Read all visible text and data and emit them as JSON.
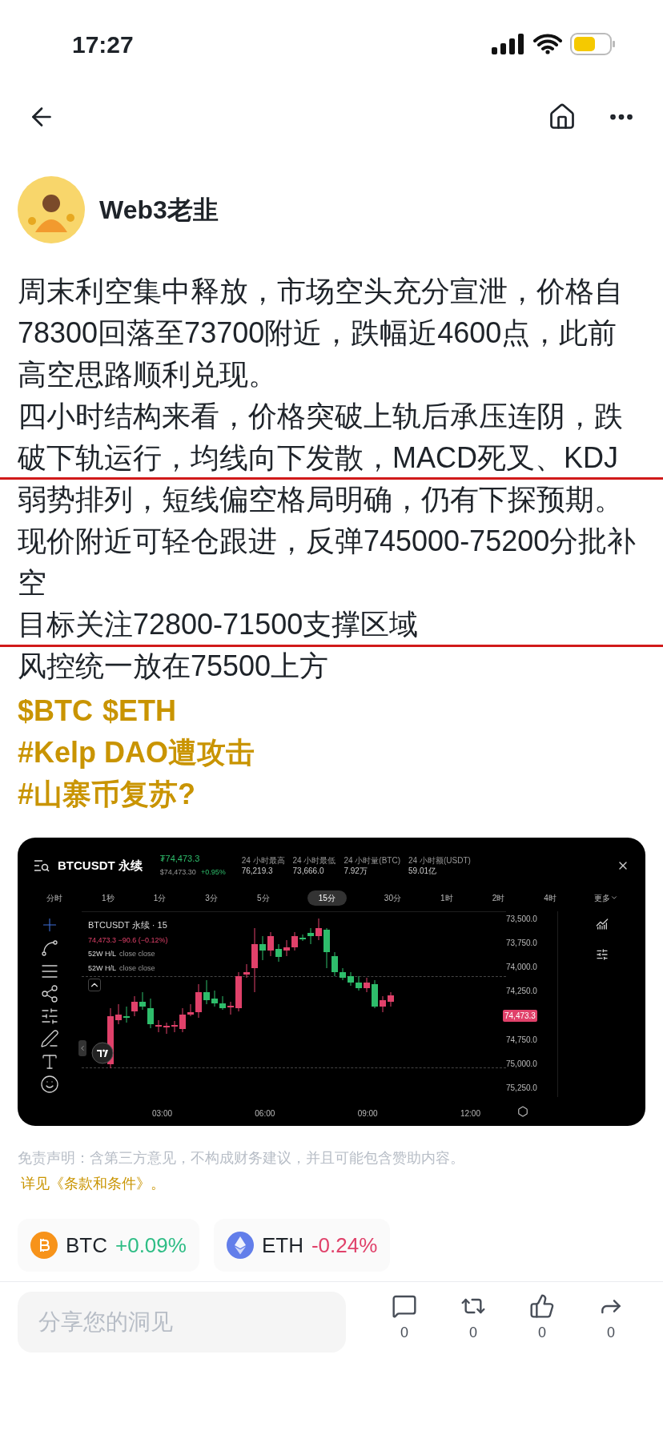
{
  "status_bar": {
    "time": "17:27"
  },
  "author": {
    "name": "Web3老韭"
  },
  "paragraphs": [
    "周末利空集中释放，市场空头充分宣泄，价格自78300回落至73700附近，跌幅近4600点，此前高空思路顺利兑现。",
    "四小时结构来看，价格突破上轨后承压连阴，跌破下轨运行，均线向下发散，MACD死叉、KDJ弱势排列，短线偏空格局明确，仍有下探预期。",
    "现价附近可轻仓跟进，反弹745000-75200分批补空",
    "目标关注72800-71500支撑区域",
    "风控统一放在75500上方"
  ],
  "tags": [
    [
      "$BTC",
      "$ETH"
    ],
    [
      "#Kelp DAO遭攻击"
    ],
    [
      "#山寨币复苏?"
    ]
  ],
  "chart_card": {
    "symbol": "BTCUSDT 永续",
    "last_price": "₮74,473.3",
    "usd_price": "$74,473.30",
    "change": "+0.95%",
    "stats": [
      {
        "label": "24 小时最高",
        "value": "76,219.3"
      },
      {
        "label": "24 小时最低",
        "value": "73,666.0"
      },
      {
        "label": "24 小时量(BTC)",
        "value": "7.92万"
      },
      {
        "label": "24 小时额(USDT)",
        "value": "59.01亿"
      }
    ],
    "timeframes": [
      {
        "label": "分时",
        "selected": false
      },
      {
        "label": "1秒",
        "selected": false
      },
      {
        "label": "1分",
        "selected": false
      },
      {
        "label": "3分",
        "selected": false
      },
      {
        "label": "5分",
        "selected": false
      },
      {
        "label": "15分",
        "selected": true
      },
      {
        "label": "30分",
        "selected": false
      },
      {
        "label": "1时",
        "selected": false
      },
      {
        "label": "2时",
        "selected": false
      },
      {
        "label": "4时",
        "selected": false
      }
    ],
    "more": "更多",
    "legend": {
      "title": "BTCUSDT 永续 · 15",
      "quote": "74,473.3 −90.6 (−0.12%)",
      "indicators": [
        {
          "name": "52W H/L",
          "values": "close close"
        },
        {
          "name": "52W H/L",
          "values": "close close"
        }
      ]
    },
    "price_axis": [
      "73,500.0",
      "73,750.0",
      "74,000.0",
      "74,250.0",
      "74,750.0",
      "75,000.0",
      "75,250.0"
    ],
    "price_tag": "74,473.3",
    "time_axis": [
      "03:00",
      "06:00",
      "09:00",
      "12:00"
    ]
  },
  "disclaimer": {
    "text": "免责声明：含第三方意见，不构成财务建议，并且可能包含赞助内容。",
    "link": "详见《条款和条件》。"
  },
  "coins": [
    {
      "kind": "bitcoin",
      "symbol": "BTC",
      "change": "+0.09%",
      "color": "#2ebd85"
    },
    {
      "kind": "ether",
      "symbol": "ETH",
      "change": "-0.24%",
      "color": "#e0416a"
    }
  ],
  "comment_box": {
    "placeholder": "分享您的洞见"
  },
  "actions": [
    {
      "kind": "comment",
      "count": "0"
    },
    {
      "kind": "repost",
      "count": "0"
    },
    {
      "kind": "like",
      "count": "0"
    },
    {
      "kind": "share",
      "count": "0"
    }
  ]
}
